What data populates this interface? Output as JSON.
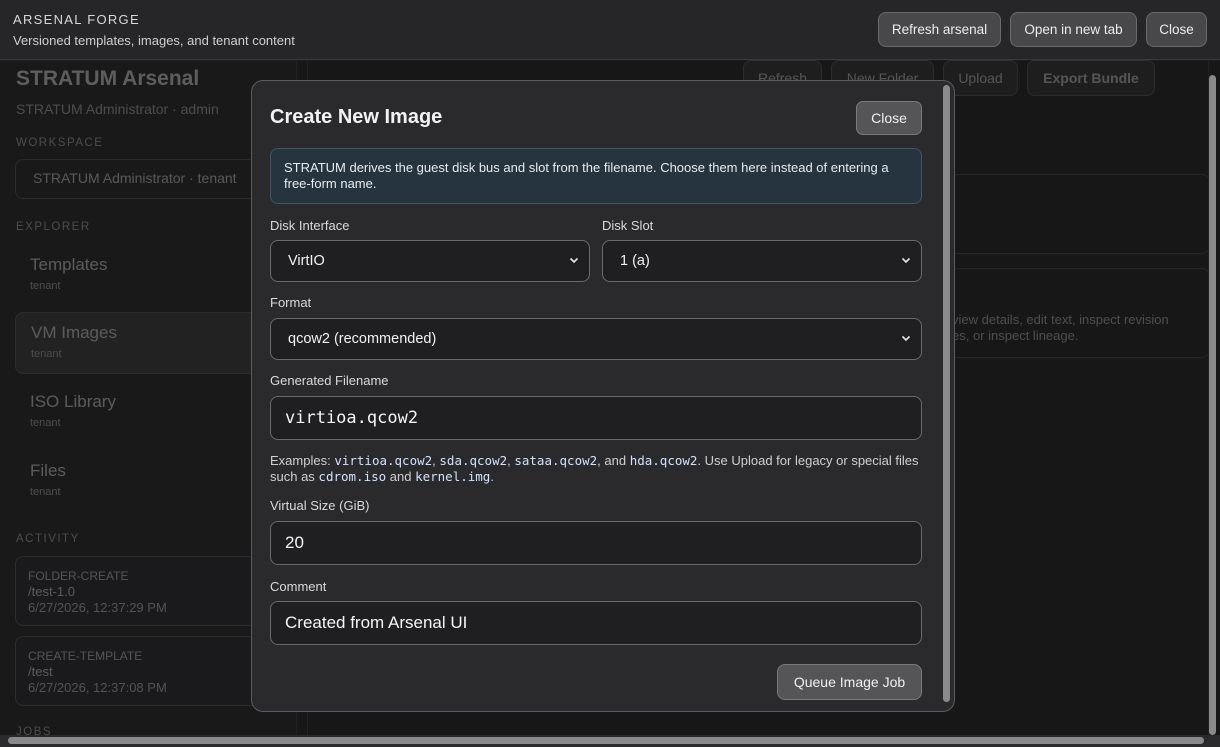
{
  "topbar": {
    "title": "ARSENAL FORGE",
    "subtitle": "Versioned templates, images, and tenant content",
    "refresh_label": "Refresh arsenal",
    "open_tab_label": "Open in new tab",
    "close_label": "Close"
  },
  "sidebar": {
    "title": "STRATUM Arsenal",
    "subtitle": "STRATUM Administrator · admin",
    "workspace_label": "WORKSPACE",
    "workspace_value": "STRATUM Administrator · tenant",
    "explorer_label": "EXPLORER",
    "items": [
      {
        "name": "Templates",
        "meta": "tenant"
      },
      {
        "name": "VM Images",
        "meta": "tenant"
      },
      {
        "name": "ISO Library",
        "meta": "tenant"
      },
      {
        "name": "Files",
        "meta": "tenant"
      }
    ],
    "activity_label": "ACTIVITY",
    "activity": [
      {
        "type": "FOLDER-CREATE",
        "path": "/test-1.0",
        "time": "6/27/2026, 12:37:29 PM"
      },
      {
        "type": "CREATE-TEMPLATE",
        "path": "/test",
        "time": "6/27/2026, 12:37:08 PM"
      }
    ],
    "jobs_label": "JOBS"
  },
  "main": {
    "toolbar": {
      "refresh": "Refresh",
      "new_folder": "New Folder",
      "upload": "Upload",
      "export": "Export Bundle"
    },
    "hint_line1": "view details, edit text, inspect revision",
    "hint_line2": "es, or inspect lineage."
  },
  "modal": {
    "title": "Create New Image",
    "close_label": "Close",
    "info_text": "STRATUM derives the guest disk bus and slot from the filename. Choose them here instead of entering a free-form name.",
    "disk_interface_label": "Disk Interface",
    "disk_interface_value": "VirtIO",
    "disk_slot_label": "Disk Slot",
    "disk_slot_value": "1 (a)",
    "format_label": "Format",
    "format_value": "qcow2 (recommended)",
    "filename_label": "Generated Filename",
    "filename_value": "virtioa.qcow2",
    "examples": {
      "prefix": "Examples: ",
      "ex1": "virtioa.qcow2",
      "sep1": ", ",
      "ex2": "sda.qcow2",
      "sep2": ", ",
      "ex3": "sataa.qcow2",
      "sep3": ", and ",
      "ex4": "hda.qcow2",
      "middle": ". Use Upload for legacy or special files such as ",
      "ex5": "cdrom.iso",
      "and": " and ",
      "ex6": "kernel.img",
      "end": "."
    },
    "virtual_size_label": "Virtual Size (GiB)",
    "virtual_size_value": "20",
    "comment_label": "Comment",
    "comment_value": "Created from Arsenal UI",
    "submit_label": "Queue Image Job"
  }
}
